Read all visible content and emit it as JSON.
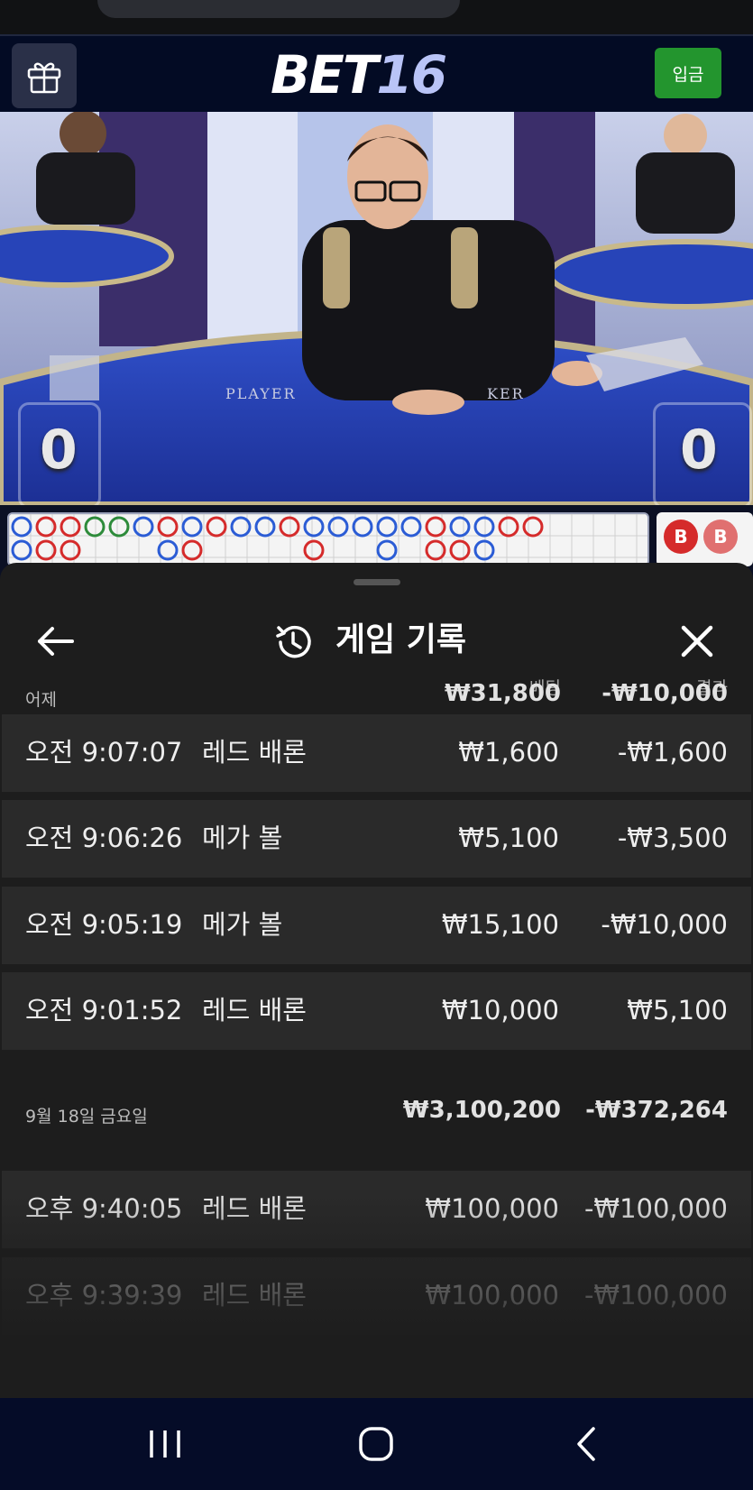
{
  "app": {
    "brand_main": "BET",
    "brand_num": "16",
    "deposit_label": "입금"
  },
  "video": {
    "player_score": "0",
    "banker_score": "0",
    "table_text_left": "PLAYER",
    "table_text_right": "KER"
  },
  "roadmap": {
    "banker_chip": "B"
  },
  "history": {
    "title": "게임 기록",
    "col_bet": "베팅",
    "col_result": "결과",
    "groups": [
      {
        "date": "어제",
        "total_bet": "₩31,800",
        "total_result": "-₩10,000",
        "entries": [
          {
            "time": "오전 9:07:07",
            "game": "레드 배론",
            "bet": "₩1,600",
            "result": "-₩1,600"
          },
          {
            "time": "오전 9:06:26",
            "game": "메가 볼",
            "bet": "₩5,100",
            "result": "-₩3,500"
          },
          {
            "time": "오전 9:05:19",
            "game": "메가 볼",
            "bet": "₩15,100",
            "result": "-₩10,000"
          },
          {
            "time": "오전 9:01:52",
            "game": "레드 배론",
            "bet": "₩10,000",
            "result": "₩5,100"
          }
        ]
      },
      {
        "date": "9월 18일 금요일",
        "total_bet": "₩3,100,200",
        "total_result": "-₩372,264",
        "entries": [
          {
            "time": "오후 9:40:05",
            "game": "레드 배론",
            "bet": "₩100,000",
            "result": "-₩100,000"
          },
          {
            "time": "오후 9:39:39",
            "game": "레드 배론",
            "bet": "₩100,000",
            "result": "-₩100,000"
          }
        ]
      }
    ]
  },
  "icons": {
    "gift": "gift-icon",
    "back": "arrow-left-icon",
    "history": "history-icon",
    "close": "close-icon",
    "nav_recent": "recent-apps-icon",
    "nav_home": "home-icon",
    "nav_back": "back-icon"
  },
  "colors": {
    "header_bg": "#030b24",
    "deposit_green": "#23952e",
    "sheet_bg": "#1d1d1d",
    "row_bg": "#2a2a2a",
    "logo_accent": "#b9c4f7"
  }
}
